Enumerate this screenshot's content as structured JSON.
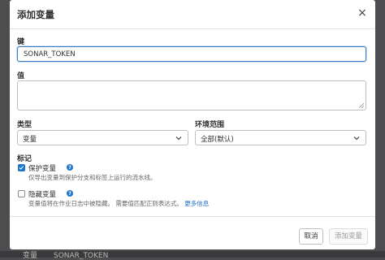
{
  "modal": {
    "title": "添加变量",
    "close_glyph": "×"
  },
  "key_field": {
    "label": "键",
    "value": "SONAR_TOKEN"
  },
  "value_field": {
    "label": "值",
    "value": ""
  },
  "type_field": {
    "label": "类型",
    "selected": "变量"
  },
  "env_field": {
    "label": "环境范围",
    "selected": "全部(默认)"
  },
  "flags": {
    "label": "标记",
    "protect": {
      "label": "保护变量",
      "checked": true,
      "hint": "仅导出变量到保护分支和标签上运行的流水线。"
    },
    "mask": {
      "label": "隐藏变量",
      "checked": false,
      "hint": "变量值将在作业日志中被隐藏。 需要值匹配正则表达式。",
      "more_link": "更多信息"
    },
    "help_glyph": "?"
  },
  "footer": {
    "cancel_label": "取消",
    "add_label": "添加变量"
  },
  "background": {
    "left_text": "变量",
    "mid_text": "SONAR_TOKEN"
  },
  "colors": {
    "accent": "#1f75cb",
    "focus_border": "#3f79c2",
    "overlay": "#4d4d4f"
  },
  "icons": {
    "close": "close-icon",
    "help": "question-circle-icon",
    "chevron": "chevron-down-icon",
    "check": "check-icon",
    "resize": "resize-handle-icon"
  }
}
